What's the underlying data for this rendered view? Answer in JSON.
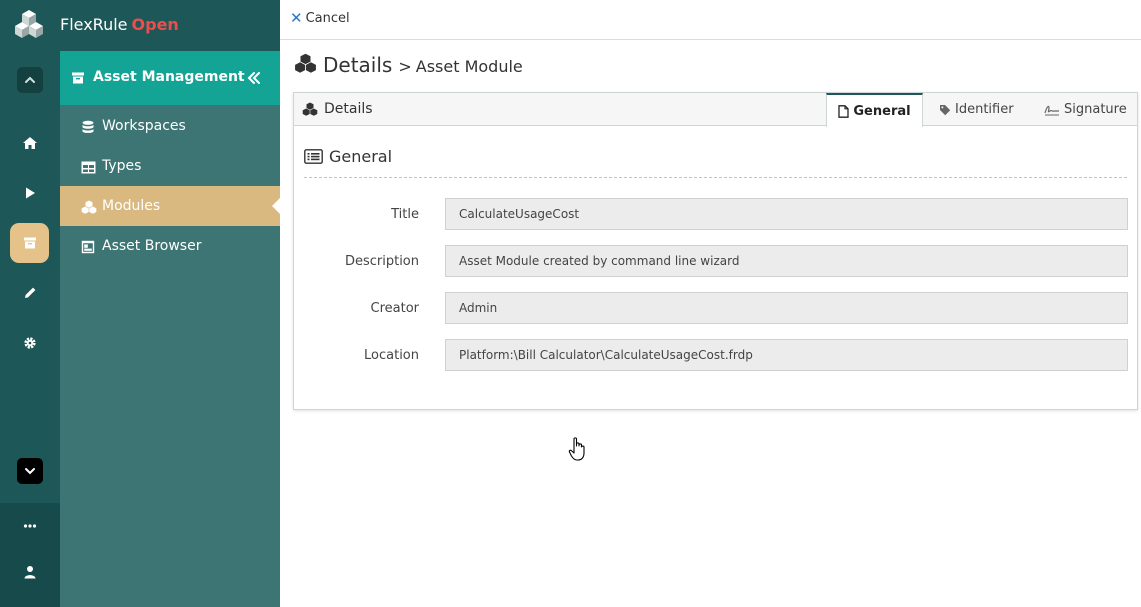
{
  "brand": {
    "name": "FlexRule",
    "edition": "Open"
  },
  "sidebar": {
    "title": "Asset Management",
    "items": [
      {
        "label": "Workspaces",
        "icon": "database-icon",
        "active": false
      },
      {
        "label": "Types",
        "icon": "table-icon",
        "active": false
      },
      {
        "label": "Modules",
        "icon": "cubes-icon",
        "active": true
      },
      {
        "label": "Asset Browser",
        "icon": "browser-icon",
        "active": false
      }
    ]
  },
  "rail": {
    "items": [
      "chevron-up-icon",
      "home-icon",
      "play-icon",
      "archive-icon",
      "pencil-icon",
      "gear-icon",
      "chevron-down-icon",
      "ellipsis-icon",
      "user-icon"
    ],
    "active": "archive-icon"
  },
  "topbar": {
    "cancel_label": "Cancel"
  },
  "breadcrumb": {
    "title": "Details",
    "separator": ">",
    "subtitle": "Asset Module"
  },
  "tabs": {
    "details_label": "Details",
    "items": [
      {
        "label": "General",
        "icon": "file-icon",
        "active": true
      },
      {
        "label": "Identifier",
        "icon": "tag-icon",
        "active": false
      },
      {
        "label": "Signature",
        "icon": "signature-icon",
        "active": false
      }
    ]
  },
  "general": {
    "title": "General",
    "fields": [
      {
        "label": "Title",
        "value": "CalculateUsageCost"
      },
      {
        "label": "Description",
        "value": "Asset Module created by command line wizard"
      },
      {
        "label": "Creator",
        "value": "Admin"
      },
      {
        "label": "Location",
        "value": "Platform:\\Bill Calculator\\CalculateUsageCost.frdp"
      }
    ]
  },
  "colors": {
    "rail": "#1d5757",
    "sidebar": "#3d7474",
    "sidebar_header": "#14a495",
    "active_item": "#dab981",
    "brand_accent": "#ee4d4d"
  }
}
